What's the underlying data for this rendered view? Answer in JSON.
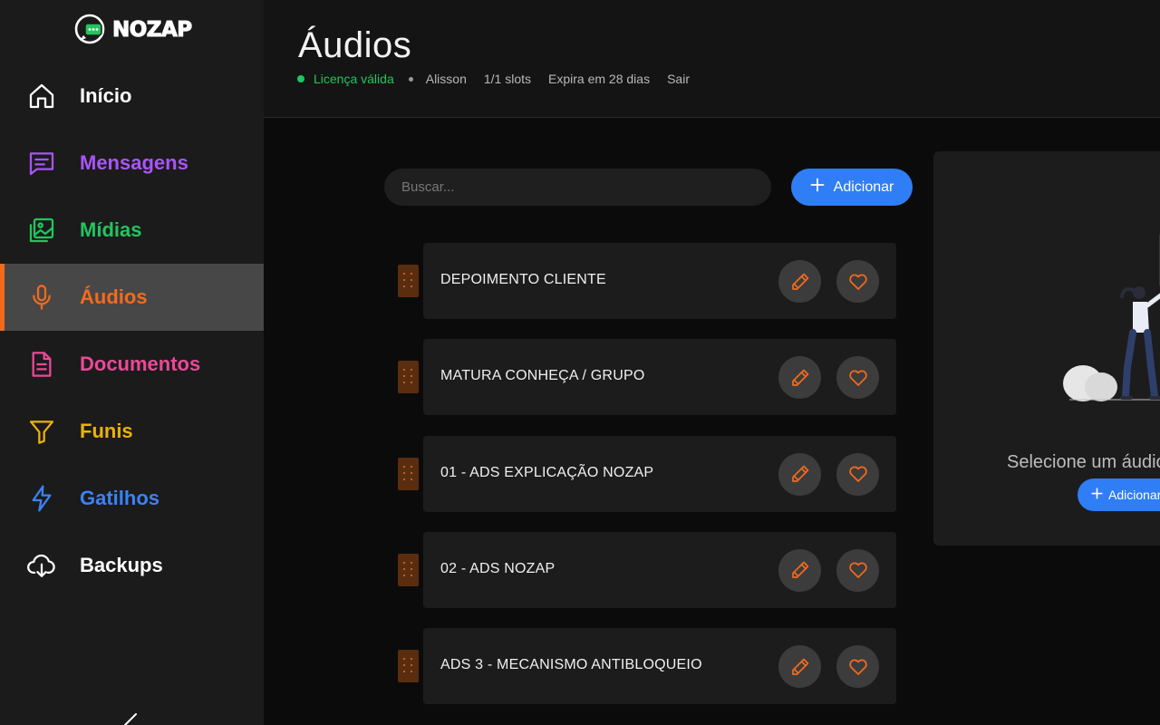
{
  "app": {
    "brand": "NOZAP"
  },
  "sidebar": {
    "items": [
      {
        "label": "Início",
        "icon": "home-icon",
        "color": "#ffffff"
      },
      {
        "label": "Mensagens",
        "icon": "message-icon",
        "color": "#a855f7"
      },
      {
        "label": "Mídias",
        "icon": "images-icon",
        "color": "#22c55e"
      },
      {
        "label": "Áudios",
        "icon": "microphone-icon",
        "color": "#f26b1d",
        "active": true
      },
      {
        "label": "Documentos",
        "icon": "document-icon",
        "color": "#ec4899"
      },
      {
        "label": "Funis",
        "icon": "filter-icon",
        "color": "#eab308"
      },
      {
        "label": "Gatilhos",
        "icon": "lightning-icon",
        "color": "#3b82f6"
      },
      {
        "label": "Backups",
        "icon": "cloud-download-icon",
        "color": "#ffffff"
      }
    ]
  },
  "header": {
    "title": "Áudios",
    "license": "Licença válida",
    "user": "Alisson",
    "slots": "1/1 slots",
    "expires": "Expira em 28 dias",
    "logout": "Sair"
  },
  "search": {
    "placeholder": "Buscar...",
    "value": ""
  },
  "toolbar": {
    "add_label": "Adicionar"
  },
  "audios": [
    {
      "title": "DEPOIMENTO CLIENTE"
    },
    {
      "title": "MATURA CONHEÇA / GRUPO"
    },
    {
      "title": "01 - ADS EXPLICAÇÃO NOZAP"
    },
    {
      "title": "02 - ADS NOZAP"
    },
    {
      "title": "ADS 3 - MECANISMO ANTIBLOQUEIO"
    }
  ],
  "panel": {
    "empty_text": "Selecione um áudio",
    "add_label": "Adicionar"
  },
  "colors": {
    "accent": "#f26b1d",
    "primary": "#2f7ef5",
    "license_ok": "#22c55e"
  }
}
